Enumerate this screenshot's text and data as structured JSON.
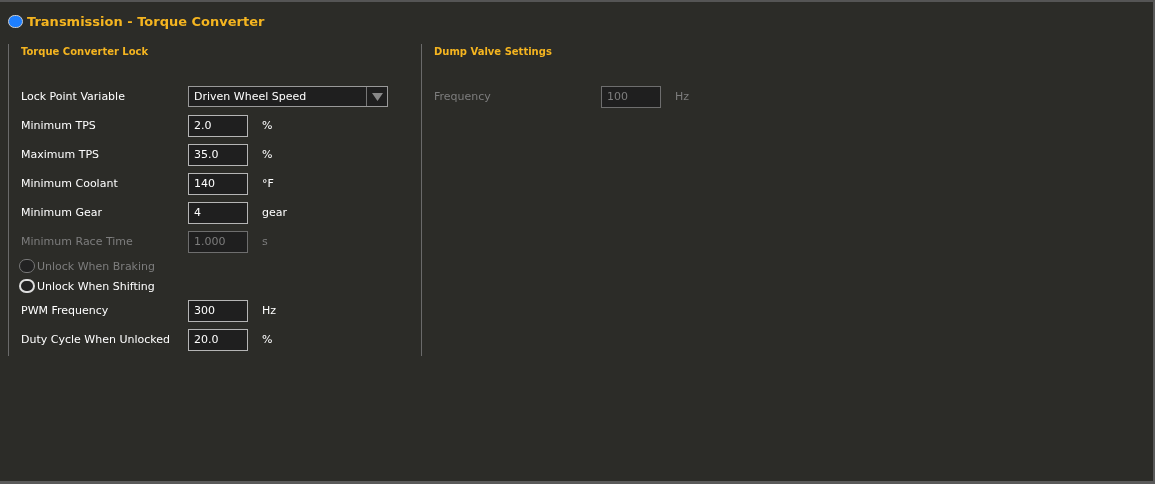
{
  "header": {
    "title": "Transmission - Torque Converter",
    "on": true
  },
  "sections": [
    {
      "title": "Torque Converter Lock",
      "rows": [
        {
          "kind": "select",
          "label": "Lock Point Variable",
          "value": "Driven Wheel Speed"
        },
        {
          "kind": "field",
          "label": "Minimum TPS",
          "value": "2.0",
          "unit": "%",
          "disabled": false
        },
        {
          "kind": "field",
          "label": "Maximum TPS",
          "value": "35.0",
          "unit": "%",
          "disabled": false
        },
        {
          "kind": "field",
          "label": "Minimum Coolant",
          "value": "140",
          "unit": "°F",
          "disabled": false
        },
        {
          "kind": "field",
          "label": "Minimum Gear",
          "value": "4",
          "unit": "gear",
          "disabled": false
        },
        {
          "kind": "field",
          "label": "Minimum Race Time",
          "value": "1.000",
          "unit": "s",
          "disabled": true
        },
        {
          "kind": "toggle",
          "label": "Unlock When Braking",
          "checked": false,
          "disabled": true
        },
        {
          "kind": "toggle",
          "label": "Unlock When Shifting",
          "checked": false,
          "disabled": false
        },
        {
          "kind": "field",
          "label": "PWM Frequency",
          "value": "300",
          "unit": "Hz",
          "disabled": false
        },
        {
          "kind": "field",
          "label": "Duty Cycle When Unlocked",
          "value": "20.0",
          "unit": "%",
          "disabled": false
        }
      ]
    },
    {
      "title": "Dump Valve Settings",
      "rows": [
        {
          "kind": "field",
          "label": "Frequency",
          "value": "100",
          "unit": "Hz",
          "disabled": true
        }
      ]
    }
  ]
}
